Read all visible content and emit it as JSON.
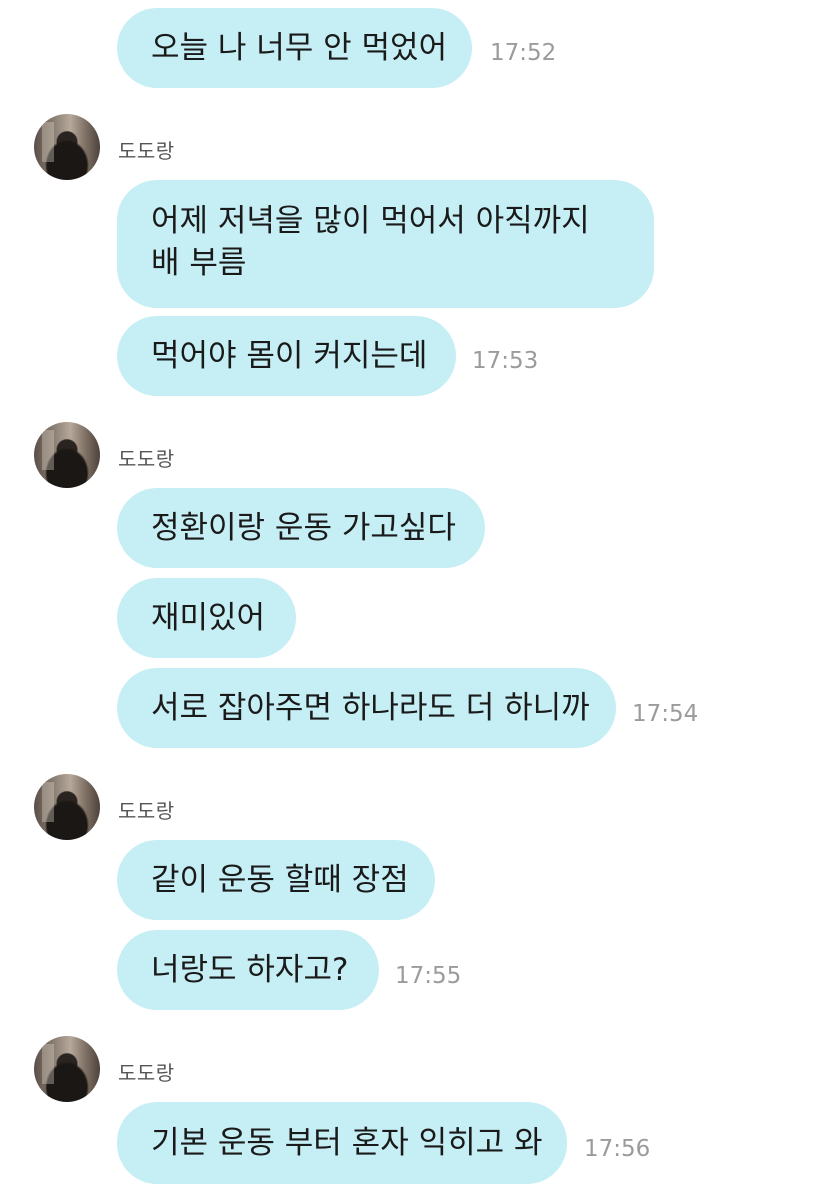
{
  "sender_name": "도도랑",
  "messages": [
    {
      "text": "오늘 나 너무 안 먹었어",
      "time": "17:52"
    },
    {
      "text": "어제 저녁을 많이 먹어서 아직까지 배 부름"
    },
    {
      "text": "먹어야 몸이 커지는데",
      "time": "17:53"
    },
    {
      "text": "정환이랑 운동 가고싶다"
    },
    {
      "text": "재미있어"
    },
    {
      "text": "서로 잡아주면 하나라도 더 하니까",
      "time": "17:54"
    },
    {
      "text": "같이 운동 할때 장점"
    },
    {
      "text": "너랑도 하자고?",
      "time": "17:55"
    },
    {
      "text": "기본 운동 부터 혼자 익히고 와",
      "time": "17:56"
    }
  ],
  "colors": {
    "bubble": "#c6eff5",
    "time": "#9b9b9b",
    "sender": "#555555"
  }
}
